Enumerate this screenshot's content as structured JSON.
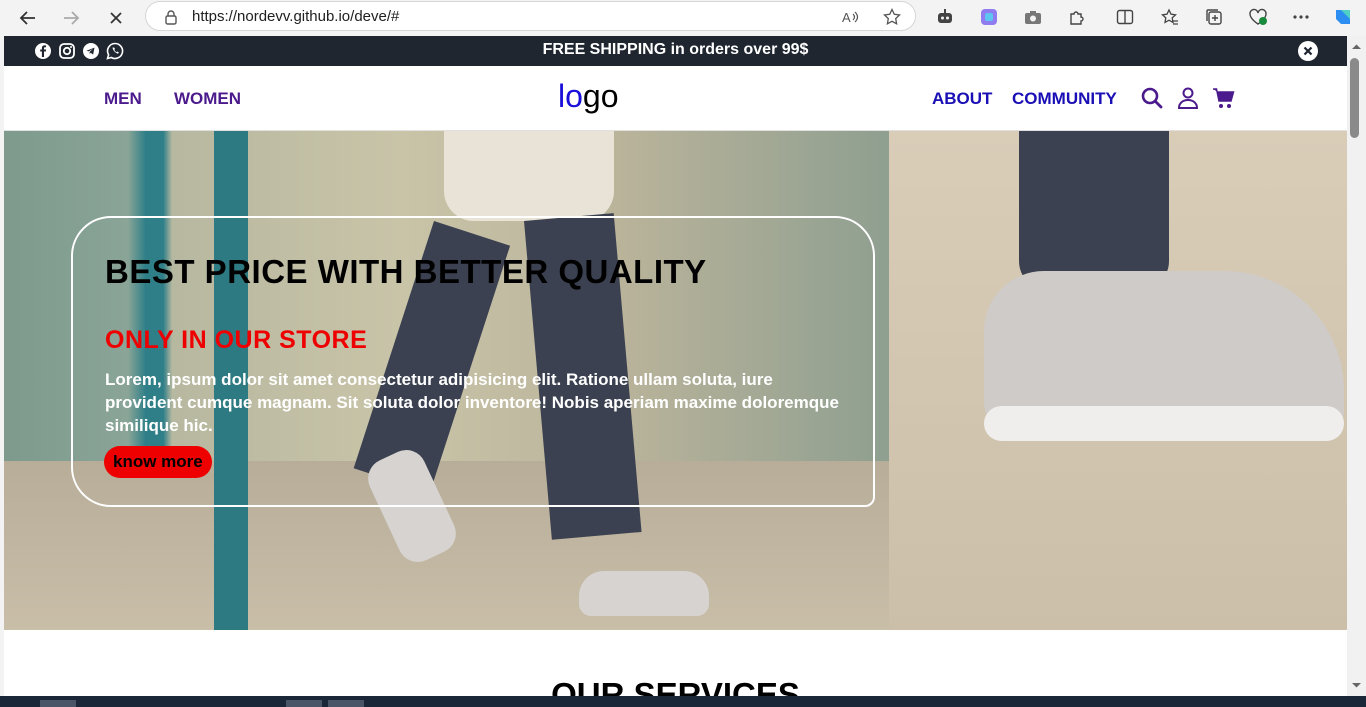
{
  "browser": {
    "url": "https://nordevv.github.io/deve/#"
  },
  "topbar": {
    "promo": "FREE SHIPPING in orders over 99$",
    "social_icons": [
      "facebook-icon",
      "instagram-icon",
      "telegram-icon",
      "whatsapp-icon"
    ]
  },
  "header": {
    "left_nav": [
      "MEN",
      "WOMEN"
    ],
    "logo_part1": "lo",
    "logo_part2": "go",
    "right_nav": [
      "ABOUT",
      "COMMUNITY"
    ],
    "icons": [
      "search-icon",
      "user-icon",
      "cart-icon"
    ]
  },
  "hero": {
    "title": "BEST PRICE WITH BETTER QUALITY",
    "subtitle": "ONLY IN OUR STORE",
    "body": "Lorem, ipsum dolor sit amet consectetur adipisicing elit. Ratione ullam soluta, iure provident cumque magnam. Sit soluta dolor inventore! Nobis aperiam maxime doloremque similique hic.",
    "button": "know more"
  },
  "services": {
    "heading": "OUR SERVICES"
  },
  "colors": {
    "left_nav": "#4b1a8c",
    "right_nav": "#1a0fb5",
    "logo_blue": "#1a0fd8",
    "accent_red": "#ee0000",
    "topbar_bg": "#1f2630"
  }
}
